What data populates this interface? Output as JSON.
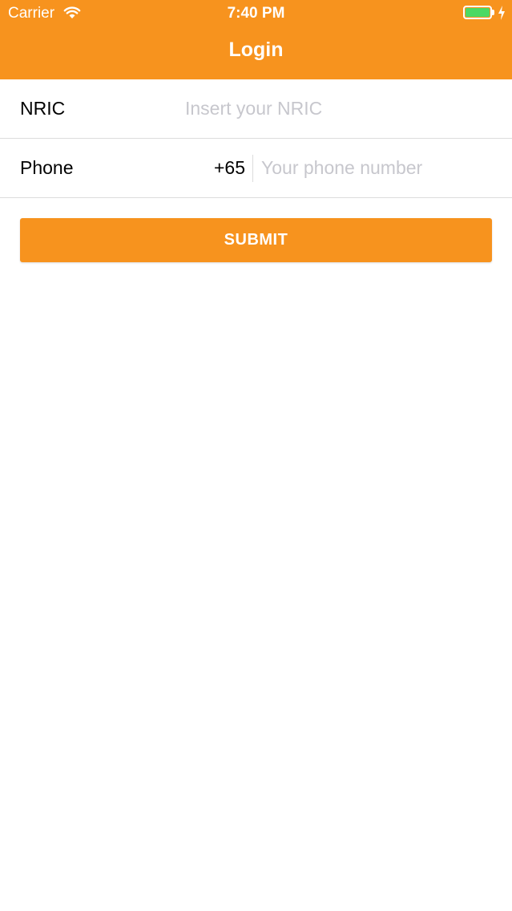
{
  "status_bar": {
    "carrier": "Carrier",
    "time": "7:40 PM",
    "wifi_icon": "wifi-icon",
    "battery_icon": "battery-icon",
    "charging_icon": "bolt-icon"
  },
  "nav": {
    "title": "Login"
  },
  "form": {
    "nric": {
      "label": "NRIC",
      "value": "",
      "placeholder": "Insert your NRIC"
    },
    "phone": {
      "label": "Phone",
      "country_code": "+65",
      "value": "",
      "placeholder": "Your phone number"
    },
    "submit_label": "SUBMIT"
  },
  "colors": {
    "accent": "#f7931e",
    "battery_fill": "#4cd964",
    "placeholder": "#c7c7cd",
    "separator": "#dcdcdc"
  }
}
